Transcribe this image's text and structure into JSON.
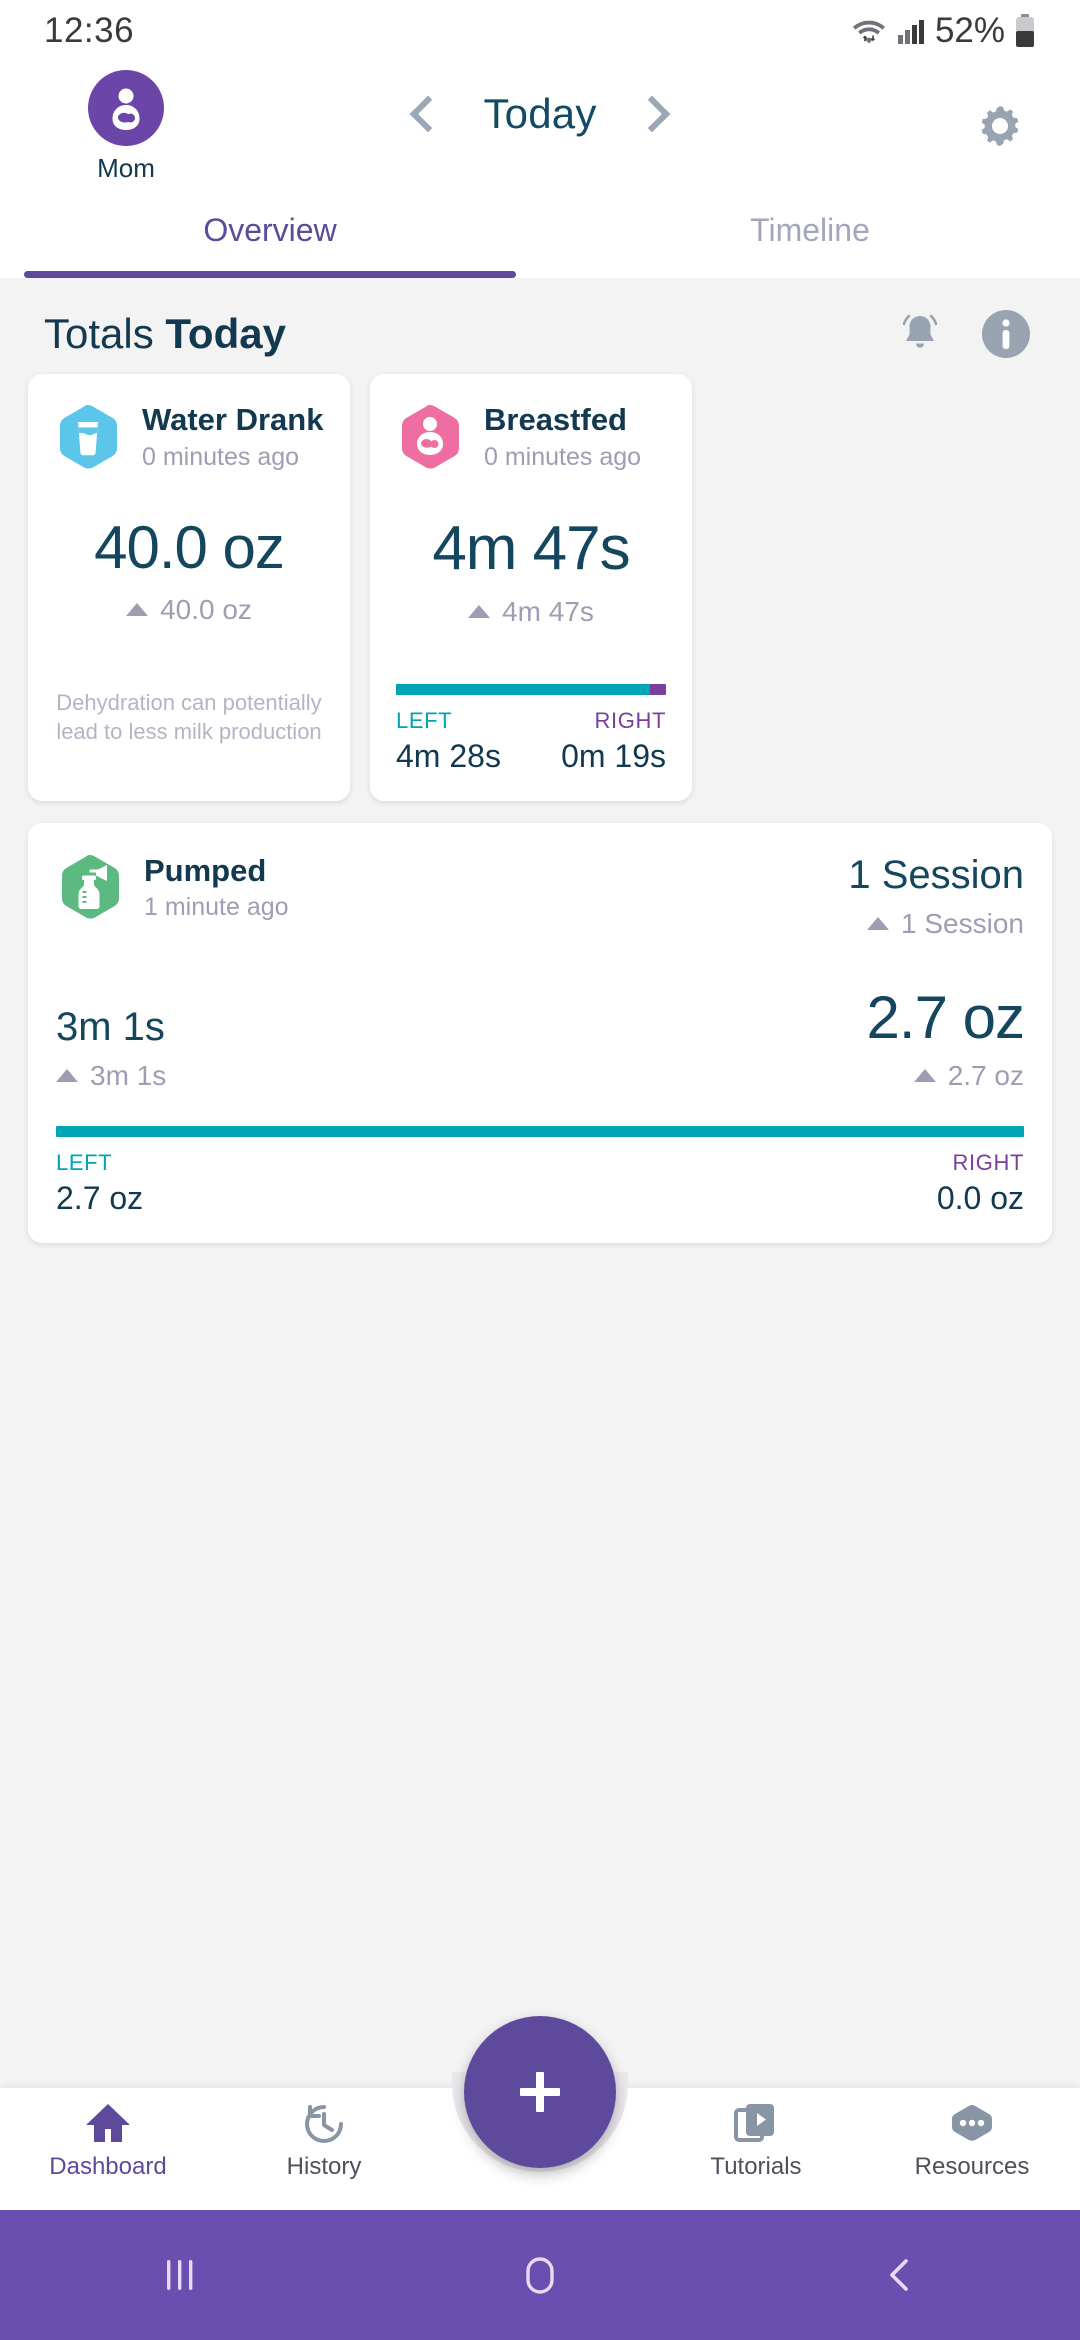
{
  "status": {
    "time": "12:36",
    "battery_percent": "52%",
    "icons": [
      "wifi-icon",
      "cellular-signal-icon",
      "battery-icon"
    ]
  },
  "appbar": {
    "profile_label": "Mom",
    "profile_icon": "nursing-mother-icon",
    "date_title": "Today",
    "prev_icon": "chevron-left-icon",
    "next_icon": "chevron-right-icon",
    "settings_icon": "gear-icon"
  },
  "tabs": [
    {
      "label": "Overview",
      "active": true
    },
    {
      "label": "Timeline",
      "active": false
    }
  ],
  "totals": {
    "title_light": "Totals ",
    "title_bold": "Today",
    "bell_icon": "bell-icon",
    "info_icon": "info-icon"
  },
  "cards": {
    "water": {
      "icon": "water-glass-icon",
      "icon_color": "#5bc5ea",
      "title": "Water Drank",
      "subtitle": "0 minutes ago",
      "value": "40.0 oz",
      "delta": "40.0 oz",
      "note": "Dehydration can potentially lead to less milk production"
    },
    "breastfed": {
      "icon": "nursing-mother-icon",
      "icon_color": "#ef6ea2",
      "title": "Breastfed",
      "subtitle": "0 minutes ago",
      "value": "4m 47s",
      "delta": "4m 47s",
      "left_label": "LEFT",
      "right_label": "RIGHT",
      "left_value": "4m 28s",
      "right_value": "0m 19s",
      "left_pct": 94,
      "right_pct": 6
    },
    "pumped": {
      "icon": "breast-pump-icon",
      "icon_color": "#5cba80",
      "title": "Pumped",
      "subtitle": "1 minute ago",
      "sessions_value": "1 Session",
      "sessions_delta": "1 Session",
      "duration_value": "3m 1s",
      "duration_delta": "3m 1s",
      "amount_value": "2.7 oz",
      "amount_delta": "2.7 oz",
      "left_label": "LEFT",
      "right_label": "RIGHT",
      "left_value": "2.7 oz",
      "right_value": "0.0 oz",
      "left_pct": 100,
      "right_pct": 0
    }
  },
  "bottom_nav": {
    "items": [
      {
        "label": "Dashboard",
        "icon": "home-icon",
        "active": true
      },
      {
        "label": "History",
        "icon": "history-clock-icon",
        "active": false
      },
      {
        "label": "Tutorials",
        "icon": "video-library-icon",
        "active": false
      },
      {
        "label": "Resources",
        "icon": "more-dots-icon",
        "active": false
      }
    ],
    "fab_icon": "plus-icon"
  },
  "system_nav": {
    "recents_icon": "recents-icon",
    "home_icon": "home-pill-icon",
    "back_icon": "back-chevron-icon"
  },
  "colors": {
    "purple": "#5d4a9c",
    "teal": "#00a5b5",
    "navy": "#12394f",
    "grey": "#9d9db4",
    "pink": "#ef6ea2",
    "green": "#5cba80",
    "blue": "#5bc5ea"
  }
}
